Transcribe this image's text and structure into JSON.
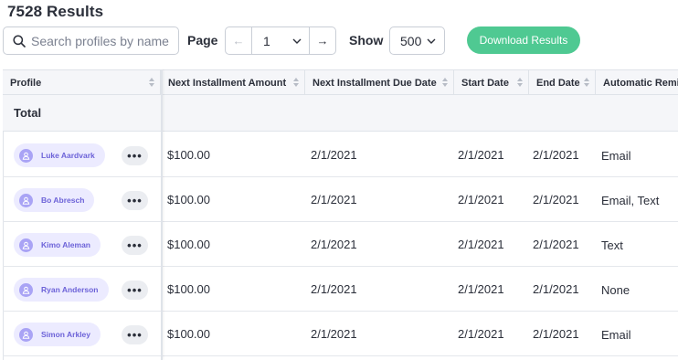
{
  "results_title": "7528 Results",
  "search": {
    "placeholder": "Search profiles by name"
  },
  "pagination": {
    "label": "Page",
    "prev_glyph": "←",
    "current_page": "1",
    "next_glyph": "→"
  },
  "show": {
    "label": "Show",
    "value": "500"
  },
  "download_label": "Download Results",
  "colors": {
    "accent_green": "#4fc992",
    "pill_bg": "#ecebff",
    "pill_text": "#6c62d8",
    "avatar": "#a9a3f5"
  },
  "table": {
    "columns": [
      "Profile",
      "Next Installment Amount",
      "Next Installment Due Date",
      "Start Date",
      "End Date",
      "Automatic Reminders"
    ],
    "total_label": "Total",
    "more_glyph": "•••",
    "rows": [
      {
        "name": "Luke Aardvark",
        "amount": "$100.00",
        "due": "2/1/2021",
        "start": "2/1/2021",
        "end": "2/1/2021",
        "reminder": "Email"
      },
      {
        "name": "Bo Abresch",
        "amount": "$100.00",
        "due": "2/1/2021",
        "start": "2/1/2021",
        "end": "2/1/2021",
        "reminder": "Email, Text"
      },
      {
        "name": "Kimo Aleman",
        "amount": "$100.00",
        "due": "2/1/2021",
        "start": "2/1/2021",
        "end": "2/1/2021",
        "reminder": "Text"
      },
      {
        "name": "Ryan Anderson",
        "amount": "$100.00",
        "due": "2/1/2021",
        "start": "2/1/2021",
        "end": "2/1/2021",
        "reminder": "None"
      },
      {
        "name": "Simon Arkley",
        "amount": "$100.00",
        "due": "2/1/2021",
        "start": "2/1/2021",
        "end": "2/1/2021",
        "reminder": "Email"
      }
    ]
  }
}
